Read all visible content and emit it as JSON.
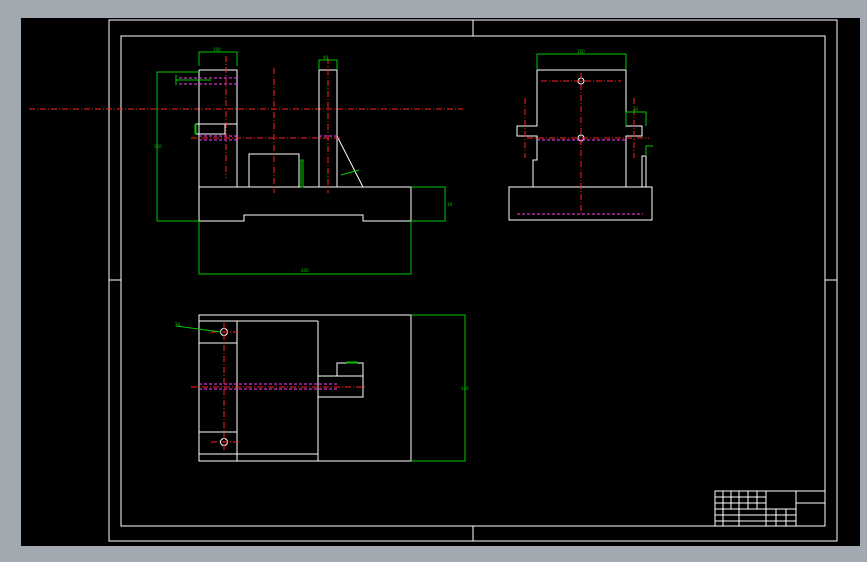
{
  "colors": {
    "background": "#a2a9b1",
    "canvas": "#000000",
    "outline": "#ffffff",
    "dimension": "#00c800",
    "centerline": "#ff2020",
    "hidden_line": "#ff40ff"
  },
  "title_block": {
    "title": "",
    "cells": [
      "",
      "",
      "",
      ""
    ]
  }
}
